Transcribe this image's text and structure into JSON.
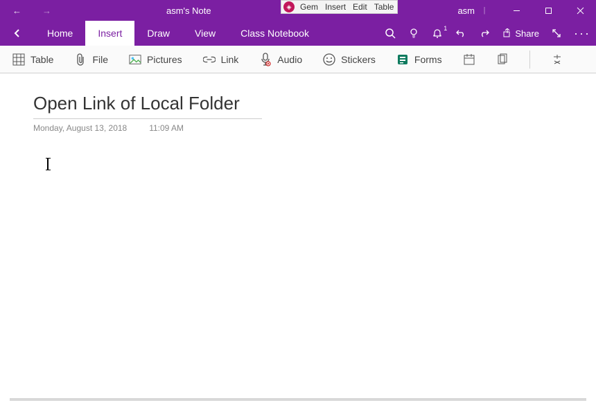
{
  "titlebar": {
    "notebook_title": "asm's Note",
    "user": "asm"
  },
  "gem_menu": {
    "items": [
      "Gem",
      "Insert",
      "Edit",
      "Table"
    ]
  },
  "tabs": {
    "home": "Home",
    "insert": "Insert",
    "draw": "Draw",
    "view": "View",
    "class_notebook": "Class Notebook"
  },
  "tools": {
    "share": "Share",
    "bell_count": "1"
  },
  "ribbon": {
    "table": "Table",
    "file": "File",
    "pictures": "Pictures",
    "link": "Link",
    "audio": "Audio",
    "stickers": "Stickers",
    "forms": "Forms"
  },
  "page": {
    "title": "Open Link of Local Folder",
    "date": "Monday, August 13, 2018",
    "time": "11:09 AM"
  }
}
